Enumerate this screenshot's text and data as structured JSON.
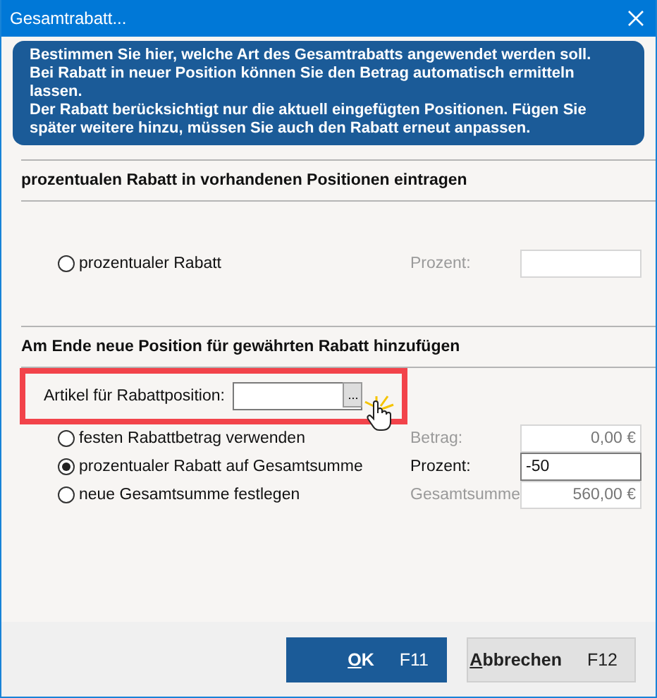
{
  "window": {
    "title": "Gesamtrabatt..."
  },
  "info": [
    "Bestimmen Sie hier, welche Art des Gesamtrabatts angewendet werden soll.",
    "Bei Rabatt in neuer Position können Sie den Betrag automatisch ermitteln lassen.",
    "Der Rabatt berücksichtigt nur die aktuell eingefügten Positionen. Fügen Sie später weitere hinzu, müssen Sie auch den Rabatt erneut anpassen."
  ],
  "sections": [
    {
      "heading": "prozentualen Rabatt in vorhandenen Positionen eintragen",
      "rows": [
        {
          "kind": "radio",
          "label": "prozentualer Rabatt",
          "selected": false,
          "field_label": "Prozent:",
          "value": "",
          "disabled": true
        }
      ]
    },
    {
      "heading": "Am Ende neue Position für gewährten Rabatt hinzufügen",
      "rows": [
        {
          "kind": "lookup",
          "label": "Artikel für Rabattposition:",
          "button": "...",
          "highlighted": true
        },
        {
          "kind": "radio",
          "label": "festen Rabattbetrag verwenden",
          "selected": false,
          "field_label": "Betrag:",
          "value": "0,00 €",
          "disabled": true
        },
        {
          "kind": "radio",
          "label": "prozentualer Rabatt auf Gesamtsumme",
          "selected": true,
          "field_label": "Prozent:",
          "value": "-50",
          "disabled": false
        },
        {
          "kind": "radio",
          "label": "neue Gesamtsumme festlegen",
          "selected": false,
          "field_label": "Gesamtsumme",
          "value": "560,00 €",
          "disabled": true
        }
      ]
    }
  ],
  "buttons": [
    {
      "label": "OK",
      "shortcut": "F11",
      "primary": true
    },
    {
      "label": "Abbrechen",
      "shortcut": "F12",
      "primary": false
    }
  ]
}
